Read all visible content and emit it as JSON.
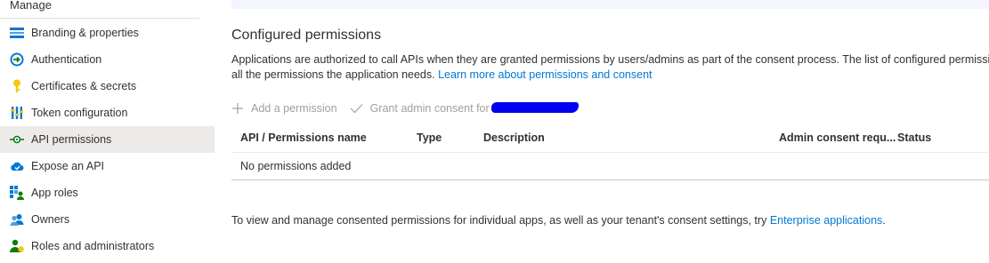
{
  "sidebar": {
    "section_header": "Manage",
    "items": [
      {
        "label": "Branding & properties",
        "icon": "branding-icon"
      },
      {
        "label": "Authentication",
        "icon": "authentication-icon"
      },
      {
        "label": "Certificates & secrets",
        "icon": "key-icon"
      },
      {
        "label": "Token configuration",
        "icon": "token-config-icon"
      },
      {
        "label": "API permissions",
        "icon": "api-permissions-icon",
        "active": true
      },
      {
        "label": "Expose an API",
        "icon": "cloud-icon"
      },
      {
        "label": "App roles",
        "icon": "app-roles-icon"
      },
      {
        "label": "Owners",
        "icon": "owners-icon"
      },
      {
        "label": "Roles and administrators",
        "icon": "roles-admin-icon"
      }
    ]
  },
  "main": {
    "title": "Configured permissions",
    "description_line1": "Applications are authorized to call APIs when they are granted permissions by users/admins as part of the consent process. The list of configured permissions s",
    "description_line2": "all the permissions the application needs.",
    "learn_more_link": "Learn more about permissions and consent",
    "toolbar": {
      "add_permission": "Add a permission",
      "grant_consent": "Grant admin consent for"
    },
    "table": {
      "columns": [
        "API / Permissions name",
        "Type",
        "Description",
        "Admin consent requ...",
        "Status"
      ],
      "empty_message": "No permissions added"
    },
    "footer_text": "To view and manage consented permissions for individual apps, as well as your tenant's consent settings, try",
    "footer_link": "Enterprise applications",
    "footer_period": "."
  },
  "colors": {
    "accent": "#0078d4",
    "active_nav_bg": "#edebe9",
    "redaction": "#0000ee"
  }
}
